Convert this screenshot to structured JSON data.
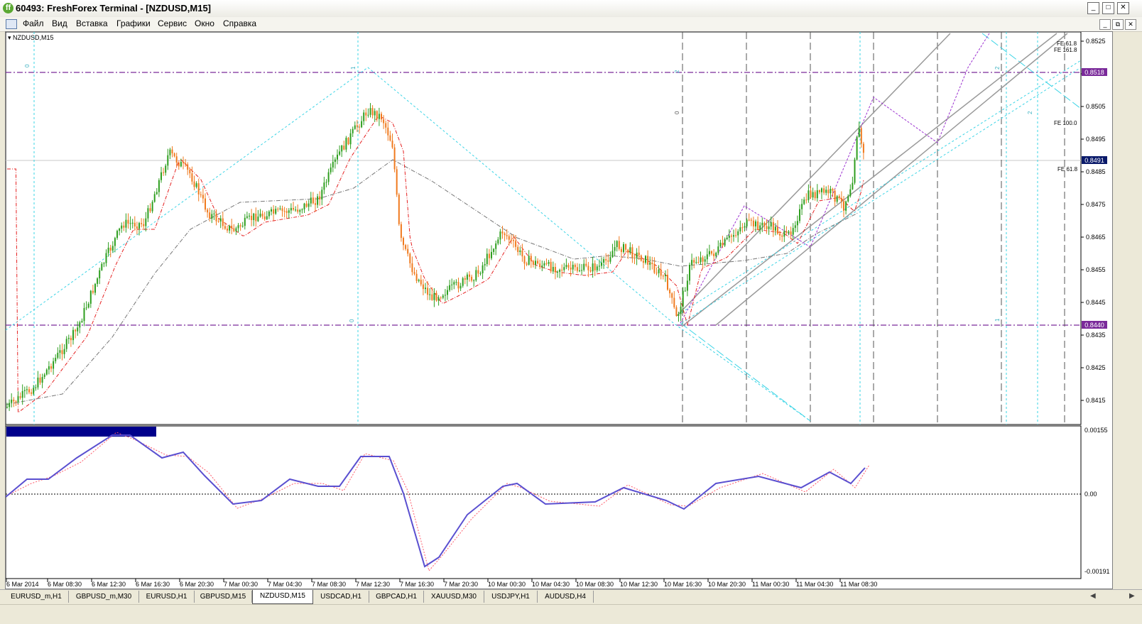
{
  "window": {
    "title": "60493: FreshForex Terminal - [NZDUSD,M15]",
    "buttons": [
      "_",
      "□",
      "✕"
    ]
  },
  "menu": {
    "items": [
      "Файл",
      "Вид",
      "Вставка",
      "Графики",
      "Сервис",
      "Окно",
      "Справка"
    ],
    "mdi_buttons": [
      "_",
      "⧉",
      "✕"
    ]
  },
  "chart": {
    "symbol_label": "NZDUSD,M15",
    "price_ticks": [
      "0.8525",
      "0.8515",
      "0.8505",
      "0.8495",
      "0.8485",
      "0.8475",
      "0.8465",
      "0.8455",
      "0.8445",
      "0.8435",
      "0.8425",
      "0.8415"
    ],
    "price_boxes": {
      "upper": "0.8518",
      "current": "0.8491",
      "lower": "0.8440"
    },
    "fib_labels": [
      "FE 61.8",
      "FE 161.8",
      "FE 100.0",
      "FE 61.8"
    ],
    "level_numbers": [
      "0",
      "1",
      "0",
      "2",
      "0",
      "2",
      "1",
      "2"
    ],
    "time_labels": [
      "6 Mar 2014",
      "6 Mar 08:30",
      "6 Mar 12:30",
      "6 Mar 16:30",
      "6 Mar 20:30",
      "7 Mar 00:30",
      "7 Mar 04:30",
      "7 Mar 08:30",
      "7 Mar 12:30",
      "7 Mar 16:30",
      "7 Mar 20:30",
      "10 Mar 00:30",
      "10 Mar 04:30",
      "10 Mar 08:30",
      "10 Mar 12:30",
      "10 Mar 16:30",
      "10 Mar 20:30",
      "11 Mar 00:30",
      "11 Mar 04:30",
      "11 Mar 08:30"
    ],
    "osc_ticks": [
      "0.00155",
      "0.00",
      "-0.00191"
    ],
    "colors": {
      "bull": "#2e9e1f",
      "bear": "#f07a1e",
      "fib_cyan": "#3ad4e6",
      "purple": "#7a2a9a",
      "oscillator": "#5a4fd0"
    }
  },
  "tabs": {
    "items": [
      "EURUSD_m,H1",
      "GBPUSD_m,M30",
      "EURUSD,H1",
      "GBPUSD,M15",
      "NZDUSD,M15",
      "USDCAD,H1",
      "GBPCAD,H1",
      "XAUUSD,M30",
      "USDJPY,H1",
      "AUDUSD,H4"
    ],
    "active": "NZDUSD,M15"
  }
}
